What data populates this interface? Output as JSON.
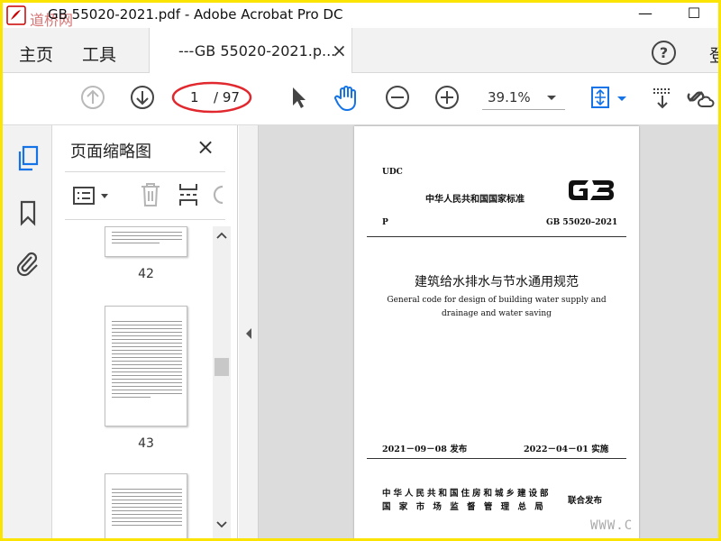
{
  "window": {
    "title": "GB 55020-2021.pdf - Adobe Acrobat Pro DC",
    "watermark": "道桥网",
    "minimize_glyph": "—",
    "maximize_glyph": "☐"
  },
  "tabs": {
    "home": "主页",
    "tools": "工具",
    "document_tab": "---GB 55020-2021.p...",
    "document_tab_close": "×",
    "help": "?",
    "signin_partial": "登"
  },
  "toolbar": {
    "current_page": "1",
    "total_pages": "/ 97",
    "zoom": "39.1%",
    "highlight_color": "#e0282e",
    "accent": "#1473e6"
  },
  "thumbnails": {
    "title": "页面缩略图",
    "close": "×",
    "pages": [
      "42",
      "43"
    ]
  },
  "document": {
    "udc": "UDC",
    "standard_type": "中华人民共和国国家标准",
    "p_mark": "P",
    "gb_logo": "GB",
    "standard_number": "GB 55020–2021",
    "title_cn": "建筑给水排水与节水通用规范",
    "title_en": "General code for design of building water supply and drainage and water saving",
    "issue_date": "2021－09－08  发布",
    "effective_date": "2022－04－01  实施",
    "ministry_line1": "中华人民共和国住房和城乡建设部",
    "ministry_line2": "国 家 市 场 监 督 管 理 总 局",
    "joint_issue": "联合发布"
  },
  "watermark_bottom": "WWW.C"
}
